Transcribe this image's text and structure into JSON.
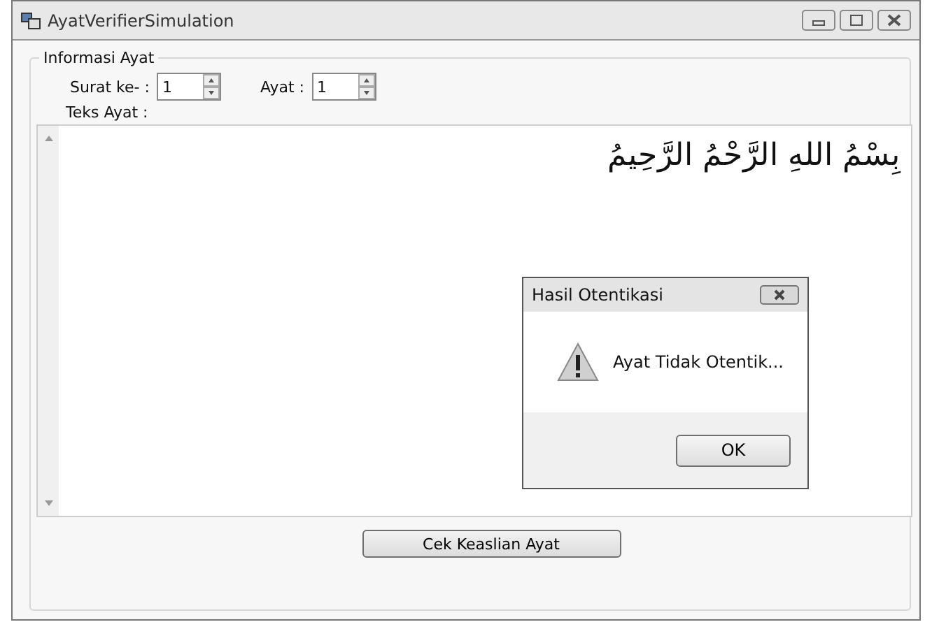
{
  "window": {
    "title": "AyatVerifierSimulation"
  },
  "group": {
    "title": "Informasi Ayat"
  },
  "fields": [
    {
      "label": "Surat ke- :",
      "value": "1"
    },
    {
      "label": "Ayat :",
      "value": "1"
    }
  ],
  "text_label": "Teks Ayat :",
  "verse_text": "بِسْمُ اللهِ الرَّحْمُ الرَّحِيمُ",
  "check_button": "Cek Keaslian Ayat",
  "dialog": {
    "title": "Hasil Otentikasi",
    "message": "Ayat Tidak Otentik...",
    "button": "OK"
  }
}
